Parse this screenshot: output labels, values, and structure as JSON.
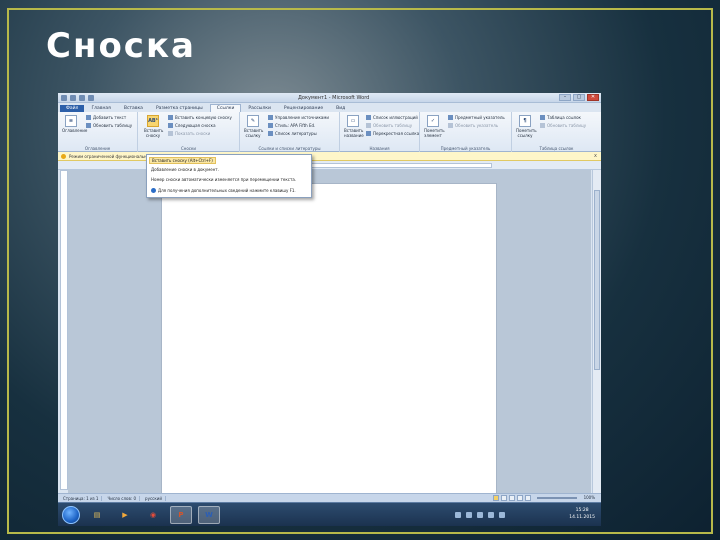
{
  "slide": {
    "title": "Сноска"
  },
  "window": {
    "title": "Документ1 - Microsoft Word",
    "controls": [
      "–",
      "▢",
      "✕"
    ]
  },
  "ribbon": {
    "tabs": [
      {
        "label": "Файл",
        "kind": "file"
      },
      {
        "label": "Главная",
        "kind": ""
      },
      {
        "label": "Вставка",
        "kind": ""
      },
      {
        "label": "Разметка страницы",
        "kind": ""
      },
      {
        "label": "Ссылки",
        "kind": "active"
      },
      {
        "label": "Рассылки",
        "kind": ""
      },
      {
        "label": "Рецензирование",
        "kind": ""
      },
      {
        "label": "Вид",
        "kind": ""
      }
    ],
    "groups": {
      "toc": {
        "name": "Оглавление",
        "big_label": "Оглавление",
        "items": [
          "Добавить текст",
          "Обновить таблицу"
        ]
      },
      "footnotes": {
        "name": "Сноски",
        "big_label": "Вставить сноску",
        "big_icon_text": "AB¹",
        "items": [
          "Вставить концевую сноску",
          "Следующая сноска",
          "Показать сноски"
        ]
      },
      "citations": {
        "name": "Ссылки и списки литературы",
        "big_label": "Вставить ссылку",
        "items": [
          "Управление источниками",
          "Стиль: APA Fifth Ed.",
          "Список литературы"
        ]
      },
      "captions": {
        "name": "Названия",
        "big_label": "Вставить название",
        "items": [
          "Список иллюстраций",
          "Обновить таблицу",
          "Перекрестная ссылка"
        ]
      },
      "index": {
        "name": "Предметный указатель",
        "big_label": "Пометить элемент",
        "items": [
          "Предметный указатель",
          "Обновить указатель"
        ]
      },
      "authorities": {
        "name": "Таблица ссылок",
        "big_label": "Пометить ссылку",
        "items": [
          "Таблица ссылок",
          "Обновить таблицу"
        ]
      }
    }
  },
  "infobar": {
    "text": "Режим ограниченной функциональности",
    "close": "x"
  },
  "dropdown": {
    "items": [
      "Вставить сноску (Alt+Ctrl+F)",
      "Добавление сноски в документ.",
      "Номер сноски автоматически изменяется при перемещении текста.",
      "Для получения дополнительных сведений нажмите клавишу F1."
    ]
  },
  "statusbar": {
    "page": "Страница: 1 из 1",
    "words": "Число слов: 0",
    "lang": "русский",
    "zoom": "100%"
  },
  "taskbar": {
    "apps": [
      {
        "name": "explorer",
        "glyph": "▤",
        "color": "#e8c15a"
      },
      {
        "name": "media-player",
        "glyph": "▶",
        "color": "#f2a93b"
      },
      {
        "name": "chrome",
        "glyph": "◉",
        "color": "#e44c3a"
      },
      {
        "name": "powerpoint",
        "glyph": "P",
        "color": "#d4552c"
      },
      {
        "name": "word",
        "glyph": "W",
        "color": "#2b5eb5"
      }
    ],
    "time": "15:28",
    "date": "14.11.2015"
  }
}
